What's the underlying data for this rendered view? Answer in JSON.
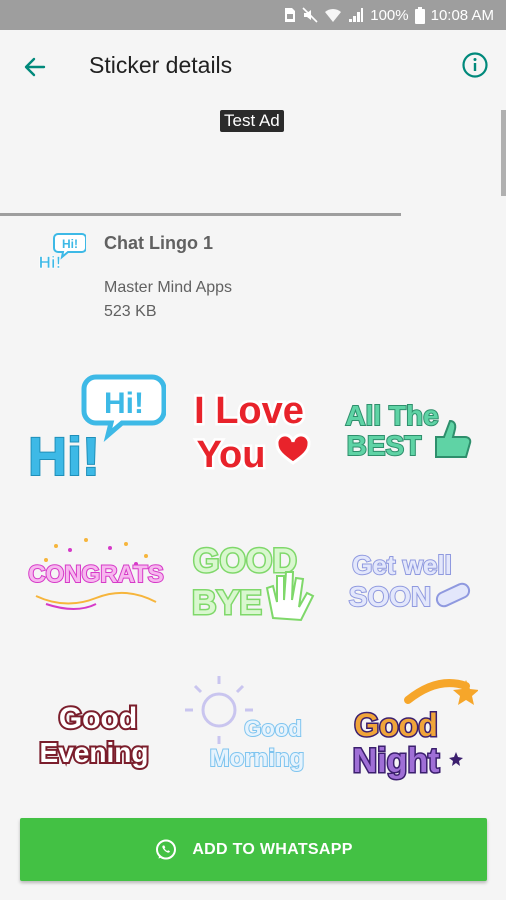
{
  "status_bar": {
    "battery": "100%",
    "time": "10:08 AM"
  },
  "app_bar": {
    "title": "Sticker details"
  },
  "ad": {
    "label": "Test Ad"
  },
  "pack": {
    "name": "Chat Lingo 1",
    "publisher": "Master Mind Apps",
    "size": "523 KB"
  },
  "stickers": [
    {
      "name": "hi-sticker",
      "text": "Hi!",
      "color": "#3db9e6"
    },
    {
      "name": "i-love-you-sticker",
      "text": "I Love You",
      "color": "#e8232b"
    },
    {
      "name": "all-the-best-sticker",
      "text": "All The BEST",
      "color": "#3aa782"
    },
    {
      "name": "congrats-sticker",
      "text": "CONGRATS",
      "color": "#d63ac8"
    },
    {
      "name": "good-bye-sticker",
      "text": "GOOD BYE",
      "color": "#8ee07a"
    },
    {
      "name": "get-well-soon-sticker",
      "text": "Get well SOON",
      "color": "#9aa3e6"
    },
    {
      "name": "good-evening-sticker",
      "text": "Good Evening",
      "color": "#7b1e2c"
    },
    {
      "name": "good-morning-sticker",
      "text": "Good Morning",
      "color": "#7ec4ef"
    },
    {
      "name": "good-night-sticker",
      "text": "Good Night",
      "color": "#3b1f6e"
    }
  ],
  "add_button": {
    "label": "ADD TO WHATSAPP"
  },
  "colors": {
    "accent": "#00897b",
    "button": "#43c144",
    "status_bar": "#9e9e9e"
  }
}
